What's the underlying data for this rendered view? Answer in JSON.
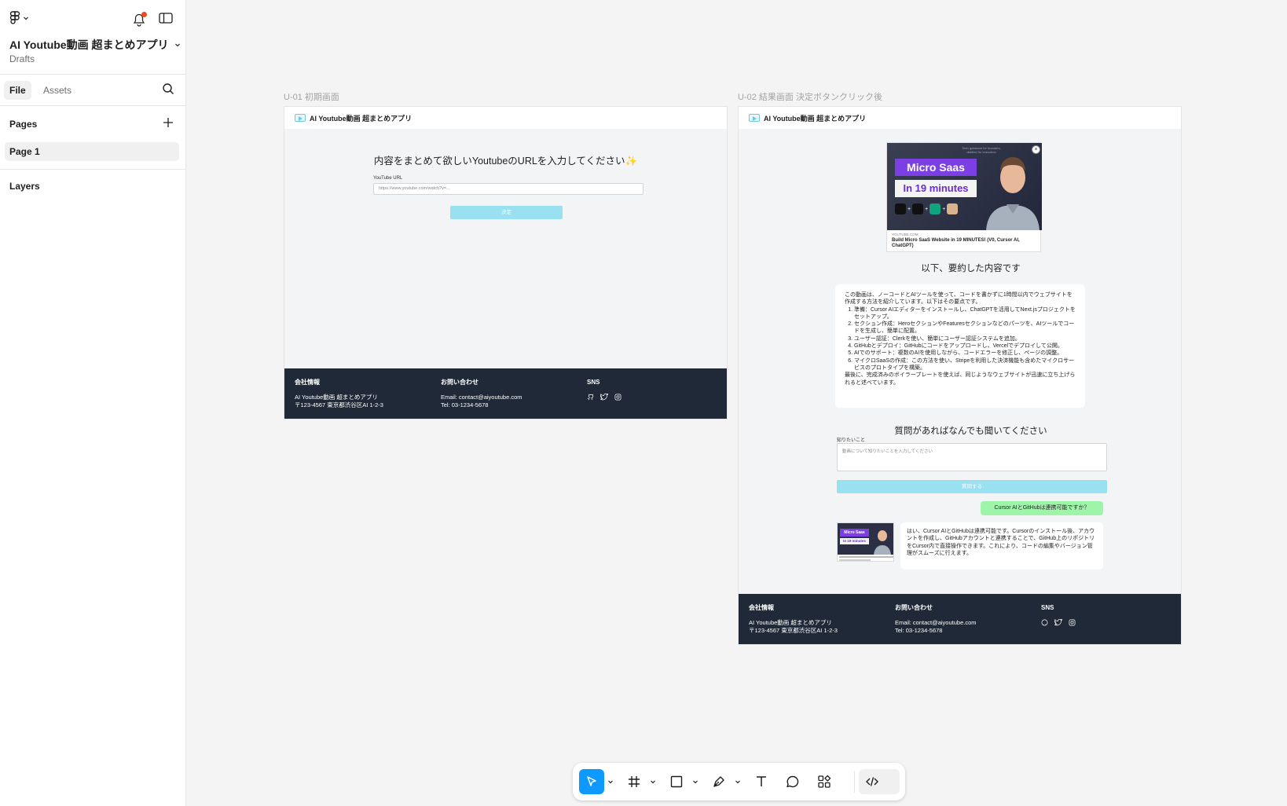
{
  "sidebar": {
    "file_title": "AI Youtube動画 超まとめアプリ",
    "file_location": "Drafts",
    "tabs": [
      {
        "label": "File"
      },
      {
        "label": "Assets"
      }
    ],
    "pages_title": "Pages",
    "pages": [
      {
        "label": "Page 1"
      }
    ],
    "layers_title": "Layers"
  },
  "canvas": {
    "frame1": {
      "label": "U-01 初期画面",
      "app_name": "AI Youtube動画 超まとめアプリ",
      "heading": "内容をまとめて欲しいYoutubeのURLを入力してください✨",
      "input_label": "YouTube URL",
      "input_placeholder": "https://www.youtube.com/watch?v=...",
      "submit_label": "決定"
    },
    "frame2": {
      "label": "U-02 結果画面 決定ボタンクリック後",
      "app_name": "AI Youtube動画 超まとめアプリ",
      "thumbnail": {
        "top_text": "Tech guidance for founders, distilled for execution",
        "badge_line1": "Micro Saas",
        "badge_line2": "In 19 minutes",
        "source": "YOUTUBE.COM",
        "title": "Build Micro SaaS Website in 19 MINUTES! (V0, Cursor AI, ChatGPT)",
        "close": "×"
      },
      "summary_heading": "以下、要約した内容です",
      "summary_intro": "この動画は、ノーコードとAIツールを使って、コードを書かずに1時間以内でウェブサイトを作成する方法を紹介しています。以下はその要点です。",
      "summary_points": [
        "準備：Cursor AIエディターをインストールし、ChatGPTを活用してNext.jsプロジェクトをセットアップ。",
        "セクション作成：HeroセクションやFeaturesセクションなどのパーツを、AIツールでコードを生成し、簡単に配置。",
        "ユーザー認証：Clerkを使い、簡単にユーザー認証システムを追加。",
        "GitHubとデプロイ：GitHubにコードをアップロードし、Vercelでデプロイして公開。",
        "AIでのサポート：複数のAIを使用しながら、コードエラーを修正し、ページの調整。",
        "マイクロSaaSの作成：この方法を使い、Stripeを利用した決済機能も含めたマイクロサービスのプロトタイプを構築。"
      ],
      "summary_outro": "最後に、完成済みのボイラープレートを使えば、同じようなウェブサイトが迅速に立ち上げられると述べています。",
      "ask_heading": "質問があればなんでも聞いてください",
      "ask_label": "知りたいこと",
      "ask_placeholder": "動画について知りたいことを入力してください",
      "ask_button": "質問する",
      "user_message": "Cursor AIとGitHubは連携可能ですか？",
      "bot_thumb_line1": "Micro Saas",
      "bot_thumb_line2": "In 19 minutes",
      "bot_message": "はい、Cursor AIとGitHubは連携可能です。Cursorのインストール後、アカウントを作成し、GitHubアカウントと連携することで、GitHub上のリポジトリをCursor内で直接操作できます。これにより、コードの編集やバージョン管理がスムーズに行えます。"
    },
    "footer": {
      "company_heading": "会社情報",
      "company_name": "AI Youtube動画 超まとめアプリ",
      "company_address": "〒123-4567 東京都渋谷区AI 1-2-3",
      "contact_heading": "お問い合わせ",
      "contact_email": "Email: contact@aiyoutube.com",
      "contact_tel": "Tel: 03-1234-5678",
      "sns_heading": "SNS",
      "sns_icons": [
        "github-icon",
        "twitter-icon",
        "instagram-icon"
      ]
    }
  },
  "toolbar": {
    "tools": [
      "move-tool",
      "frame-tool",
      "shape-tool",
      "pen-tool",
      "text-tool",
      "comment-tool",
      "actions-tool",
      "dev-mode-toggle"
    ],
    "active_tool": "move-tool"
  },
  "colors": {
    "accent": "#0d99ff",
    "footer_bg": "#1f2937",
    "button_bg": "#99e0f0",
    "user_bubble": "#9ef5a9",
    "notification": "#f24822"
  }
}
